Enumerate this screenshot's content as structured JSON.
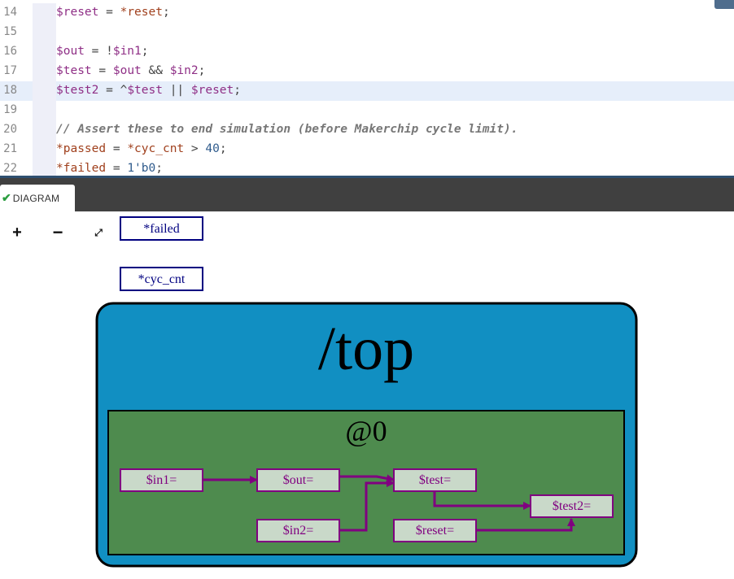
{
  "editor": {
    "lines": [
      {
        "num": "14",
        "active": false,
        "tokens": [
          {
            "t": "$reset",
            "c": "var"
          },
          {
            "t": " = ",
            "c": ""
          },
          {
            "t": "*reset",
            "c": "pipe"
          },
          {
            "t": ";",
            "c": ""
          }
        ]
      },
      {
        "num": "15",
        "active": false,
        "tokens": []
      },
      {
        "num": "16",
        "active": false,
        "tokens": [
          {
            "t": "$out",
            "c": "var"
          },
          {
            "t": " = !",
            "c": ""
          },
          {
            "t": "$in1",
            "c": "var"
          },
          {
            "t": ";",
            "c": ""
          }
        ]
      },
      {
        "num": "17",
        "active": false,
        "tokens": [
          {
            "t": "$test",
            "c": "var"
          },
          {
            "t": " = ",
            "c": ""
          },
          {
            "t": "$out",
            "c": "var"
          },
          {
            "t": " && ",
            "c": ""
          },
          {
            "t": "$in2",
            "c": "var"
          },
          {
            "t": ";",
            "c": ""
          }
        ]
      },
      {
        "num": "18",
        "active": true,
        "tokens": [
          {
            "t": "$test2",
            "c": "var"
          },
          {
            "t": " = ^",
            "c": ""
          },
          {
            "t": "$test",
            "c": "var"
          },
          {
            "t": " || ",
            "c": ""
          },
          {
            "t": "$reset",
            "c": "var"
          },
          {
            "t": ";",
            "c": ""
          }
        ]
      },
      {
        "num": "19",
        "active": false,
        "tokens": []
      },
      {
        "num": "20",
        "active": false,
        "tokens": [
          {
            "t": "// Assert these to end simulation (before Makerchip cycle limit).",
            "c": "comment"
          }
        ]
      },
      {
        "num": "21",
        "active": false,
        "tokens": [
          {
            "t": "*passed",
            "c": "pipe"
          },
          {
            "t": " = ",
            "c": ""
          },
          {
            "t": "*cyc_cnt",
            "c": "pipe"
          },
          {
            "t": " > ",
            "c": ""
          },
          {
            "t": "40",
            "c": "num"
          },
          {
            "t": ";",
            "c": ""
          }
        ]
      },
      {
        "num": "22",
        "active": false,
        "tokens": [
          {
            "t": "*failed",
            "c": "pipe"
          },
          {
            "t": " = ",
            "c": ""
          },
          {
            "t": "1'b0",
            "c": "num"
          },
          {
            "t": ";",
            "c": ""
          }
        ]
      }
    ]
  },
  "tabs": {
    "diagram_label": "DIAGRAM",
    "check_icon": "✔"
  },
  "controls": {
    "zoom_in": "+",
    "zoom_out": "−",
    "fit": "⤢"
  },
  "diagram": {
    "sig_failed": "*failed",
    "sig_cyc_cnt": "*cyc_cnt",
    "scope_label": "/top",
    "stage_label": "@0",
    "nodes": {
      "in1": "$in1=",
      "out": "$out=",
      "test": "$test=",
      "in2": "$in2=",
      "reset": "$reset=",
      "test2": "$test2="
    }
  },
  "colors": {
    "scope_fill": "#118fc2",
    "stage_fill": "#4e8b4e",
    "node_fill": "#c9d9c9",
    "node_stroke": "#800080",
    "node_text": "#800080",
    "signal_stroke": "#000080",
    "signal_text": "#000080"
  }
}
